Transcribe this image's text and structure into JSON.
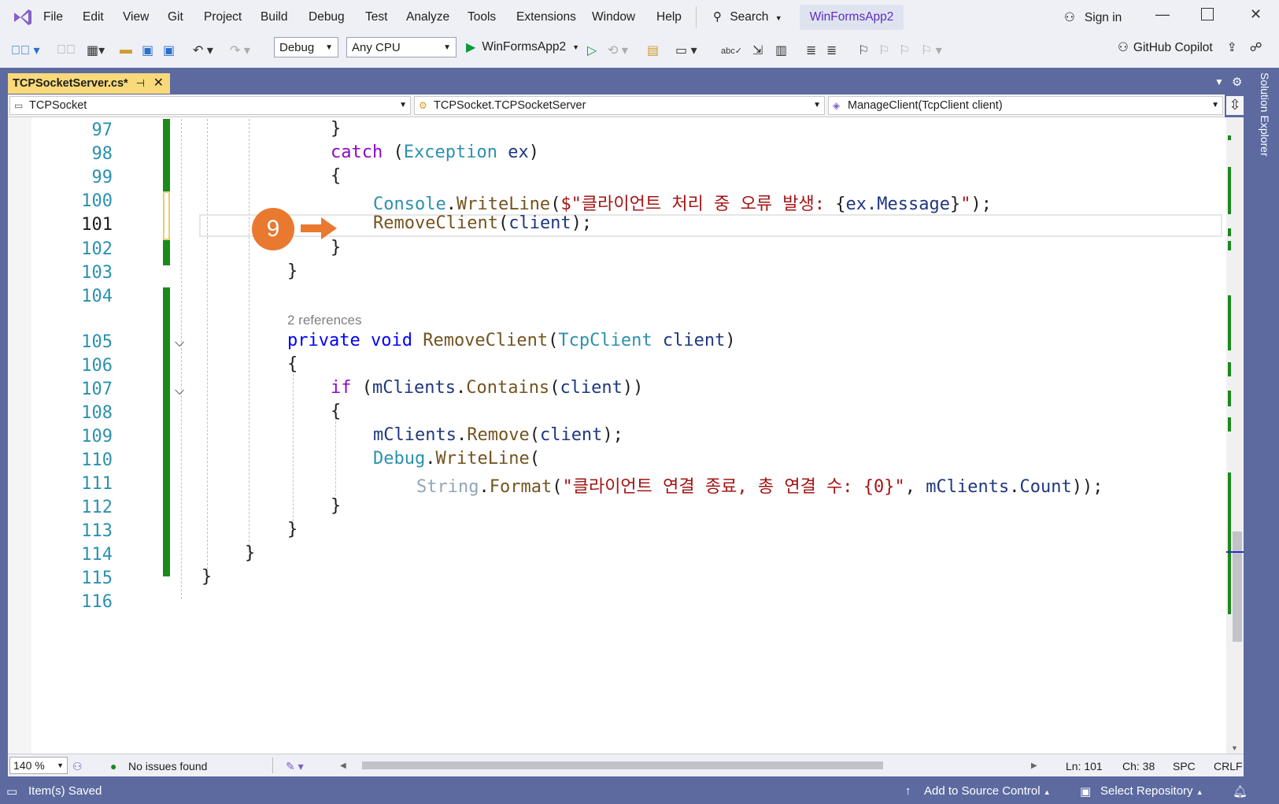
{
  "menu": [
    "File",
    "Edit",
    "View",
    "Git",
    "Project",
    "Build",
    "Debug",
    "Test",
    "Analyze",
    "Tools",
    "Extensions",
    "Window",
    "Help"
  ],
  "search_label": "Search",
  "project_name": "WinFormsApp2",
  "sign_in": "Sign in",
  "toolbar": {
    "config": "Debug",
    "platform": "Any CPU",
    "run_target": "WinFormsApp2",
    "copilot": "GitHub Copilot"
  },
  "doc_tab": "TCPSocketServer.cs*",
  "solution_explorer": "Solution Explorer",
  "nav": {
    "project": "TCPSocket",
    "class": "TCPSocket.TCPSocketServer",
    "member": "ManageClient(TcpClient client)"
  },
  "line_numbers": [
    "97",
    "98",
    "99",
    "100",
    "101",
    "102",
    "103",
    "104",
    "105",
    "106",
    "107",
    "108",
    "109",
    "110",
    "111",
    "112",
    "113",
    "114",
    "115",
    "116"
  ],
  "code": {
    "l97": "}",
    "l98_kw": "catch",
    "l98_type": "Exception",
    "l98_var": "ex",
    "l100_type": "Console",
    "l100_method": "WriteLine",
    "l100_str": "$\"클라이언트 처리 중 오류 발생: ",
    "l100_interp": "ex.Message",
    "l100_str_end": "\"",
    "l101_method": "RemoveClient",
    "l101_arg": "client",
    "references": "2 references",
    "l105_kw1": "private",
    "l105_kw2": "void",
    "l105_method": "RemoveClient",
    "l105_type": "TcpClient",
    "l105_param": "client",
    "l107_kw": "if",
    "l107_field": "mClients",
    "l107_method": "Contains",
    "l107_arg": "client",
    "l109_field": "mClients",
    "l109_method": "Remove",
    "l109_arg": "client",
    "l110_type": "Debug",
    "l110_method": "WriteLine",
    "l111_type": "String",
    "l111_method": "Format",
    "l111_str": "\"클라이언트 연결 종료, 총 연결 수: {0}\"",
    "l111_field": "mClients",
    "l111_prop": "Count"
  },
  "badge": "9",
  "status": {
    "zoom": "140 %",
    "issues": "No issues found",
    "ln": "Ln: 101",
    "ch": "Ch: 38",
    "spc": "SPC",
    "crlf": "CRLF"
  },
  "bottom": {
    "saved": "Item(s) Saved",
    "source_control": "Add to Source Control",
    "repository": "Select Repository"
  },
  "colors": {
    "frame": "#5c6aa0",
    "tab_active": "#f9d97a",
    "change_bar": "#1a8a1a",
    "badge": "#e8792f"
  }
}
